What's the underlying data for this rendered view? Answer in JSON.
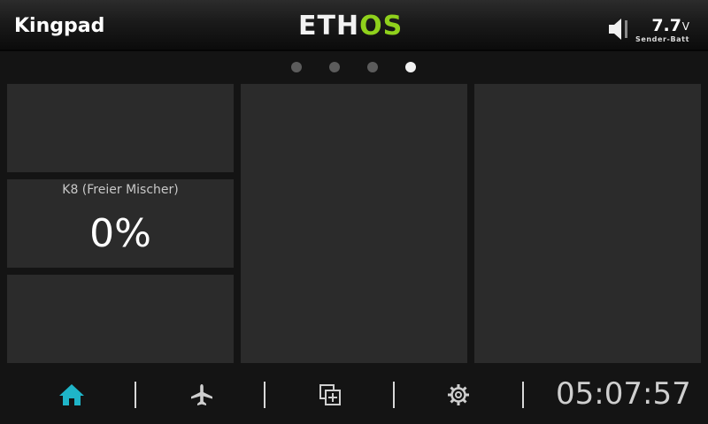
{
  "header": {
    "model_name": "Kingpad",
    "logo_left": "ETH",
    "logo_right": "OS",
    "battery_value": "7.7",
    "battery_unit": "V",
    "battery_label": "Sender-Batt",
    "speaker_icon": "speaker-icon"
  },
  "pages": {
    "count": 4,
    "active_index": 3
  },
  "widgets": {
    "mixer": {
      "title": "K8 (Freier Mischer)",
      "value": "0%"
    }
  },
  "toolbar": {
    "icons": [
      "home-icon",
      "airplane-icon",
      "widgets-icon",
      "gear-icon"
    ],
    "active_color": "#1fb5c8",
    "clock": "05:07:57"
  },
  "colors": {
    "logo_accent": "#8fd11c",
    "panel": "#2b2b2b",
    "background": "#141414"
  }
}
